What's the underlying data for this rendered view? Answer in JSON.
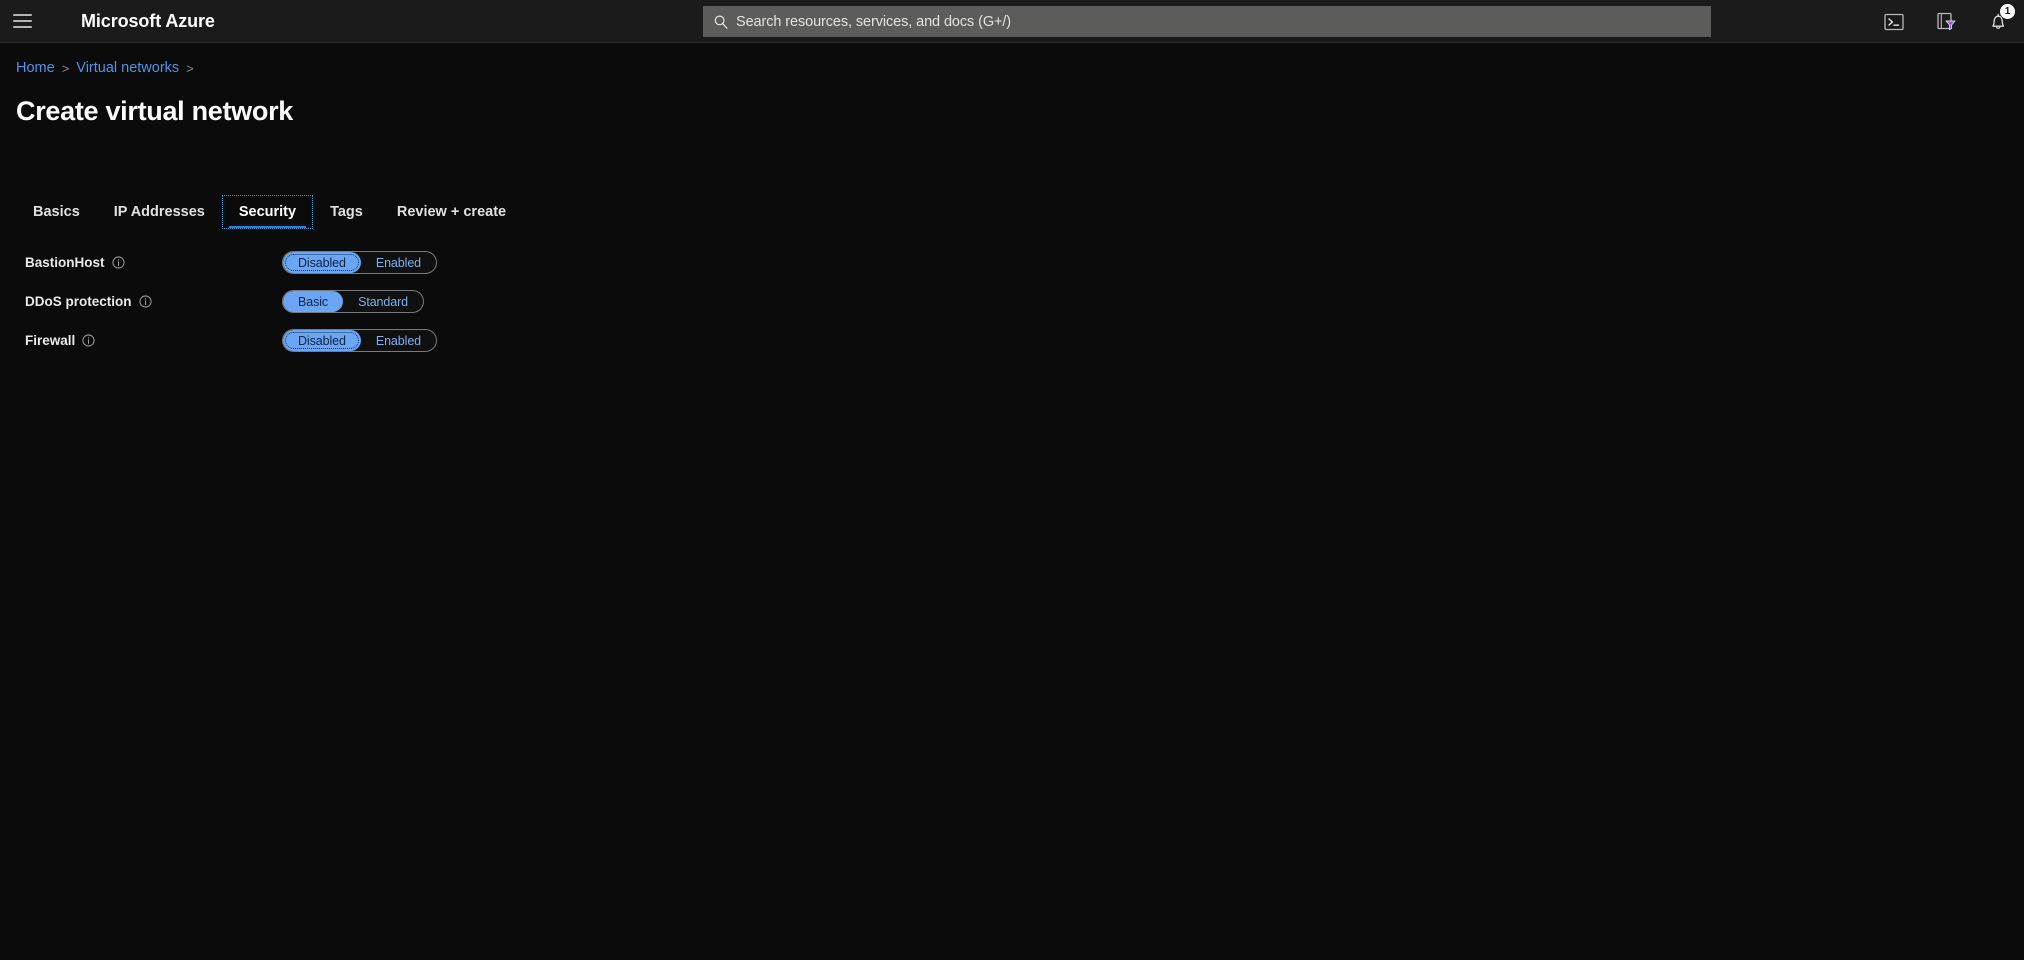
{
  "topbar": {
    "menu_icon": "hamburger-icon",
    "brand": "Microsoft Azure",
    "search": {
      "icon": "search-icon",
      "placeholder": "Search resources, services, and docs (G+/)",
      "value": ""
    },
    "actions": [
      {
        "name": "cloud-shell-icon",
        "label": "Cloud Shell"
      },
      {
        "name": "directories-filter-icon",
        "label": "Directories + subscriptions"
      },
      {
        "name": "notifications-bell-icon",
        "label": "Notifications",
        "badge": "1"
      }
    ]
  },
  "breadcrumb": {
    "items": [
      {
        "label": "Home"
      },
      {
        "label": "Virtual networks"
      }
    ],
    "separator": ">"
  },
  "page": {
    "title": "Create virtual network"
  },
  "tabs": [
    {
      "label": "Basics",
      "active": false
    },
    {
      "label": "IP Addresses",
      "active": false
    },
    {
      "label": "Security",
      "active": true
    },
    {
      "label": "Tags",
      "active": false
    },
    {
      "label": "Review + create",
      "active": false
    }
  ],
  "form": {
    "rows": [
      {
        "label": "BastionHost",
        "info_icon": "info-icon",
        "options": [
          {
            "label": "Disabled",
            "selected": true,
            "focused": true
          },
          {
            "label": "Enabled",
            "selected": false,
            "focused": false
          }
        ]
      },
      {
        "label": "DDoS protection",
        "info_icon": "info-icon",
        "options": [
          {
            "label": "Basic",
            "selected": true,
            "focused": false
          },
          {
            "label": "Standard",
            "selected": false,
            "focused": false
          }
        ]
      },
      {
        "label": "Firewall",
        "info_icon": "info-icon",
        "options": [
          {
            "label": "Disabled",
            "selected": true,
            "focused": true
          },
          {
            "label": "Enabled",
            "selected": false,
            "focused": false
          }
        ]
      }
    ]
  },
  "colors": {
    "page_background": "#0b0b0b",
    "topbar_background": "#1b1b1b",
    "search_background": "#5c5c59",
    "link_blue": "#4d95e8",
    "accent_blue": "#6aa6f5",
    "tab_underline": "#2e7cd6",
    "focus_outline": "#3aa0d8"
  }
}
